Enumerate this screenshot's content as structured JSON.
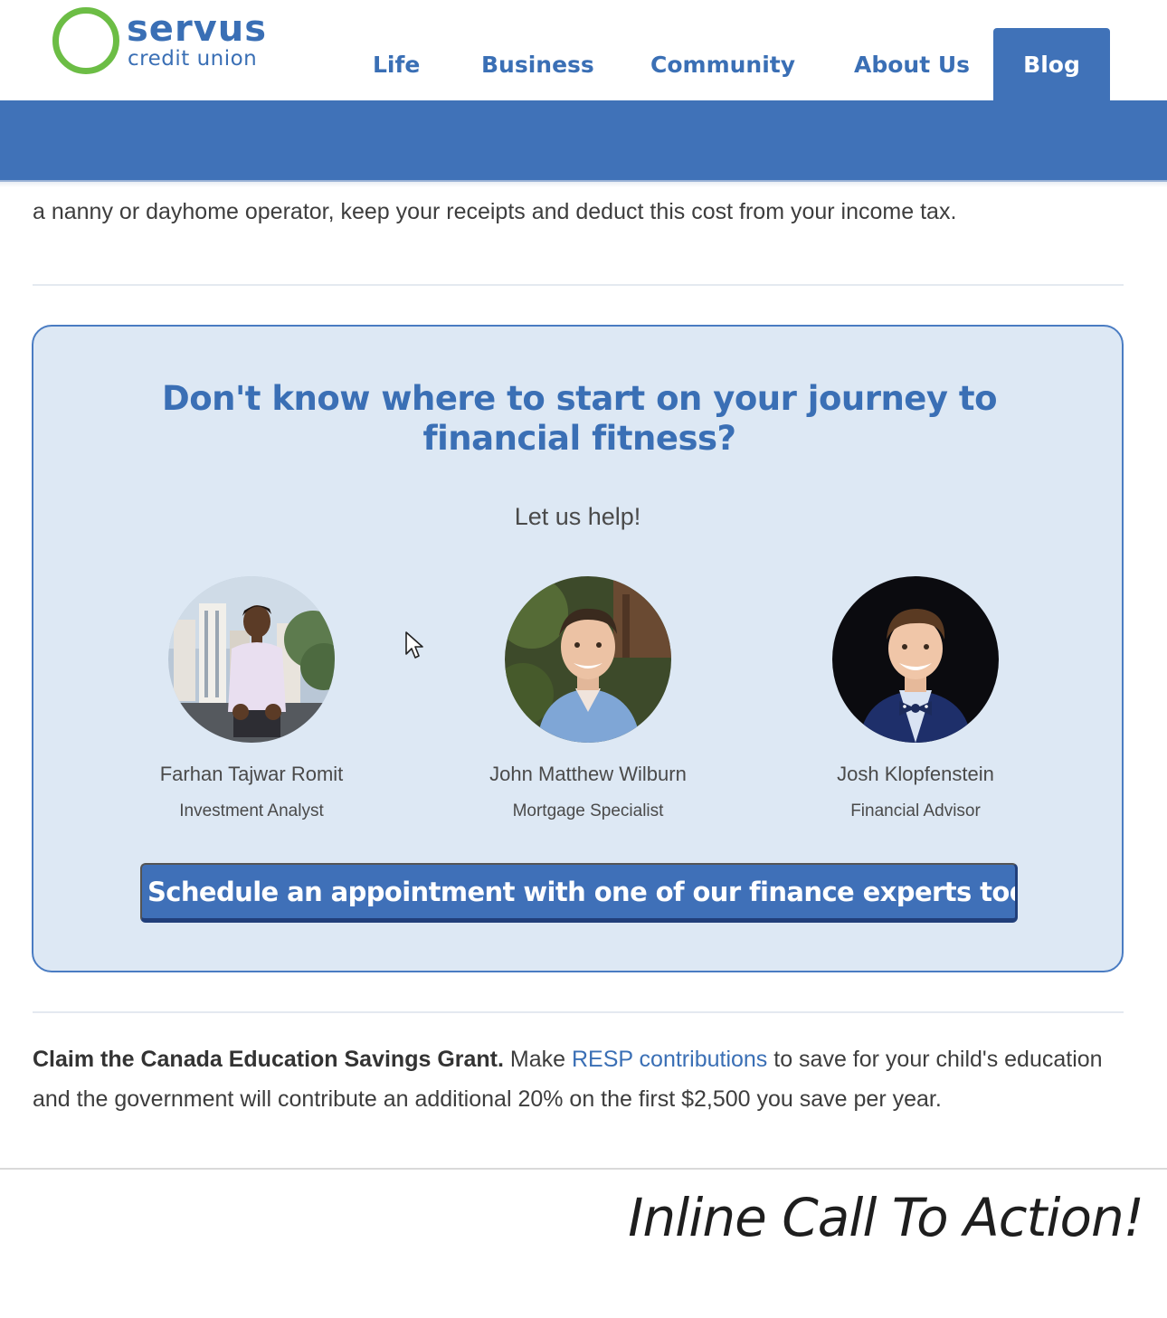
{
  "brand": {
    "name": "servus",
    "tagline": "credit union",
    "ring_color": "#6cbd45",
    "brand_color": "#3a6fb5"
  },
  "nav": {
    "items": [
      "Life",
      "Business",
      "Community",
      "About Us"
    ],
    "active": "Blog",
    "active_bg": "#4072b8"
  },
  "article": {
    "intro_line": "a nanny or dayhome operator, keep your receipts and deduct this cost from your income tax.",
    "grant_bold": "Claim the Canada Education Savings Grant.",
    "grant_pre_link": " Make ",
    "grant_link": "RESP contributions",
    "grant_post_link": " to save for your child's education and the government will contribute an additional 20% on the first $2,500 you save per year."
  },
  "cta": {
    "title": "Don't know where to start on your journey to financial fitness?",
    "subtitle": "Let us help!",
    "button_label": "Schedule an appointment with one of our finance experts today",
    "card_bg": "#dde8f4",
    "experts": [
      {
        "name": "Farhan Tajwar Romit",
        "role": "Investment Analyst",
        "photo": "outdoor-city-portrait"
      },
      {
        "name": "John Matthew Wilburn",
        "role": "Mortgage Specialist",
        "photo": "outdoor-garden-portrait"
      },
      {
        "name": "Josh Klopfenstein",
        "role": "Financial Advisor",
        "photo": "studio-bowtie-portrait"
      }
    ]
  },
  "caption": "Inline Call To Action!"
}
